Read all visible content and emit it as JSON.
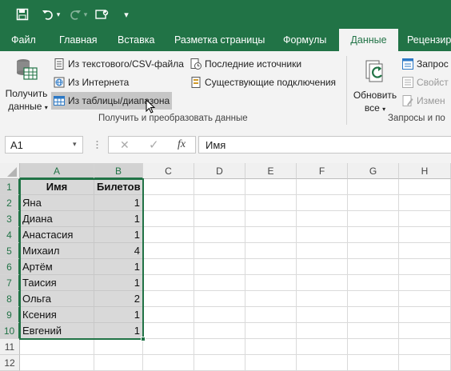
{
  "tabs": [
    {
      "label": "Файл"
    },
    {
      "label": "Главная"
    },
    {
      "label": "Вставка"
    },
    {
      "label": "Разметка страницы"
    },
    {
      "label": "Формулы"
    },
    {
      "label": "Данные"
    },
    {
      "label": "Рецензир"
    }
  ],
  "active_tab": "Данные",
  "ribbon": {
    "get_data": {
      "line1": "Получить",
      "line2": "данные"
    },
    "from_text_csv": "Из текстового/CSV-файла",
    "from_web": "Из Интернета",
    "from_table": "Из таблицы/диапазона",
    "recent_sources": "Последние источники",
    "existing_connections": "Существующие подключения",
    "group1_label": "Получить и преобразовать данные",
    "refresh_all": {
      "line1": "Обновить",
      "line2": "все"
    },
    "queries": "Запрос",
    "properties": "Свойст",
    "edit_links": "Измен",
    "group2_label": "Запросы и по"
  },
  "formula_bar": {
    "name_box": "A1",
    "fx": "fx",
    "formula": "Имя"
  },
  "columns": [
    "A",
    "B",
    "C",
    "D",
    "E",
    "F",
    "G",
    "H"
  ],
  "rows": [
    "1",
    "2",
    "3",
    "4",
    "5",
    "6",
    "7",
    "8",
    "9",
    "10",
    "11",
    "12"
  ],
  "table": {
    "headers": [
      "Имя",
      "Билетов"
    ],
    "data": [
      [
        "Яна",
        "1"
      ],
      [
        "Диана",
        "1"
      ],
      [
        "Анастасия",
        "1"
      ],
      [
        "Михаил",
        "4"
      ],
      [
        "Артём",
        "1"
      ],
      [
        "Таисия",
        "1"
      ],
      [
        "Ольга",
        "2"
      ],
      [
        "Ксения",
        "1"
      ],
      [
        "Евгений",
        "1"
      ]
    ]
  },
  "colors": {
    "accent": "#217346",
    "selection": "#d9d9d9"
  }
}
